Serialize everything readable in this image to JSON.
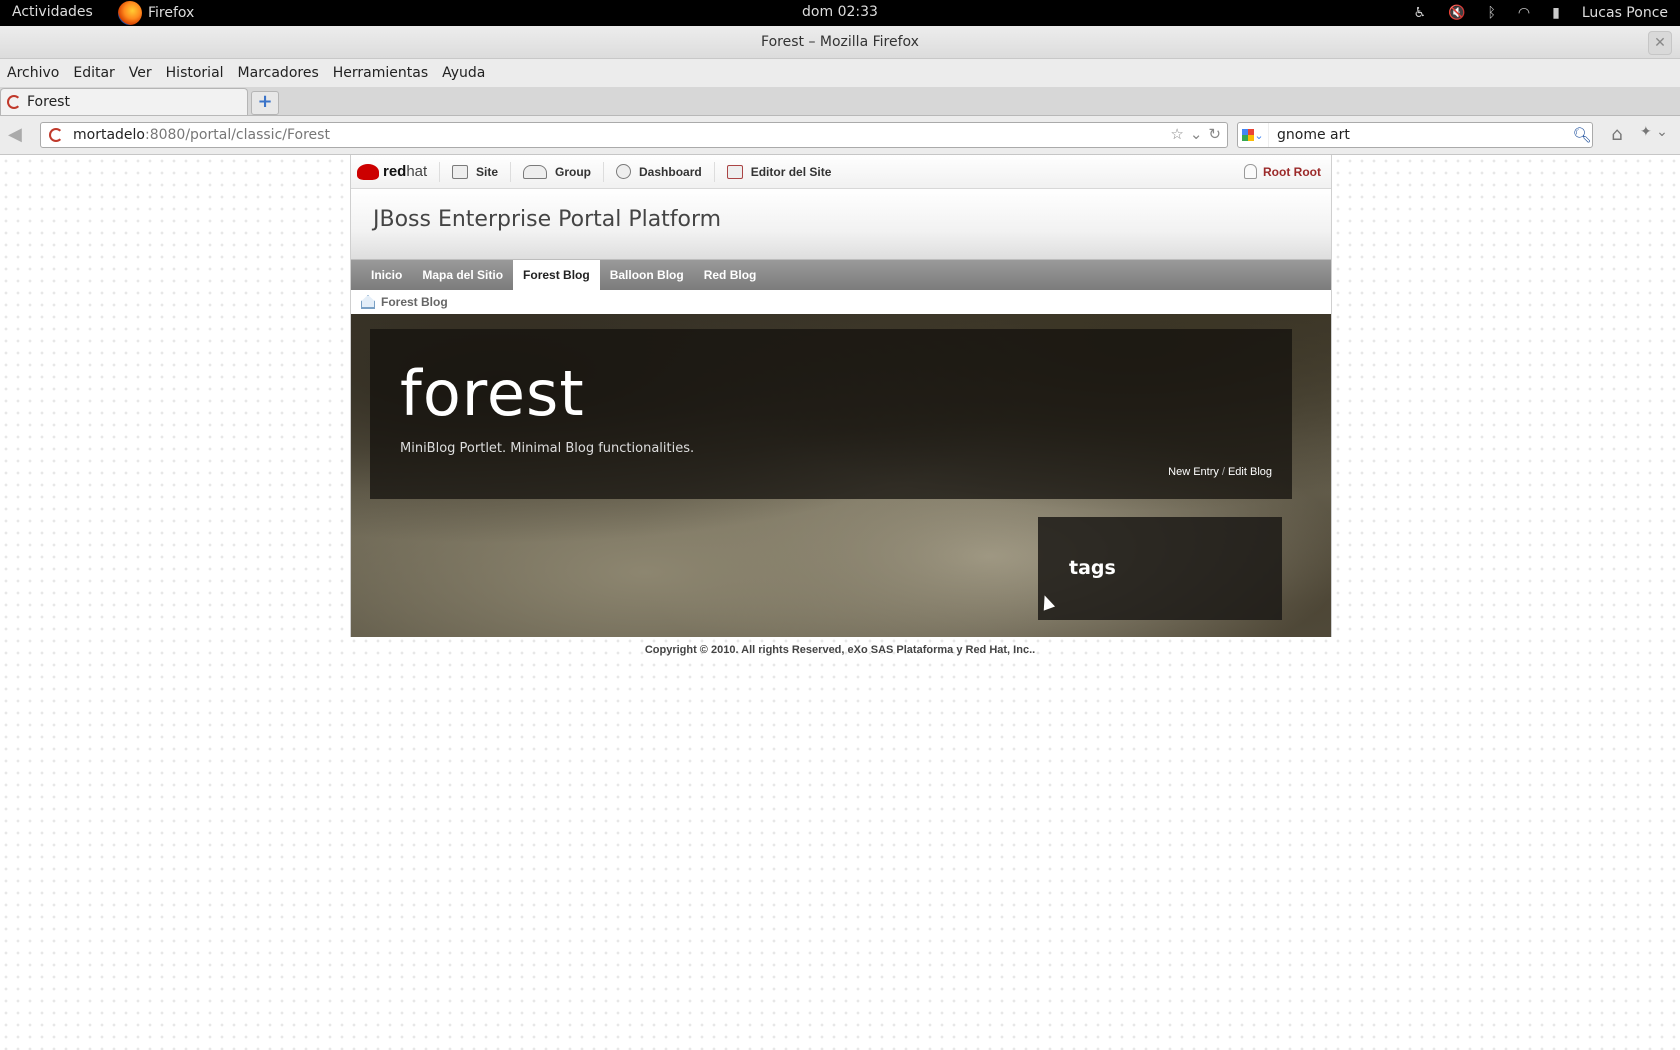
{
  "topbar": {
    "activities": "Actividades",
    "app": "Firefox",
    "clock": "dom 02:33",
    "user": "Lucas Ponce",
    "tray_icons": [
      "accessibility-icon",
      "volume-icon",
      "bluetooth-icon",
      "wifi-icon",
      "battery-icon"
    ]
  },
  "window": {
    "title": "Forest – Mozilla Firefox",
    "close": "✕"
  },
  "menubar": [
    "Archivo",
    "Editar",
    "Ver",
    "Historial",
    "Marcadores",
    "Herramientas",
    "Ayuda"
  ],
  "tab": {
    "label": "Forest",
    "new_tab": "+"
  },
  "navbar": {
    "url_host": "mortadelo",
    "url_rest": ":8080/portal/classic/Forest",
    "search_query": "gnome art"
  },
  "portal": {
    "logo": {
      "brand": "red",
      "brand2": "hat"
    },
    "toolbar": [
      {
        "label": "Site",
        "icon": "site-icon"
      },
      {
        "label": "Group",
        "icon": "group-icon"
      },
      {
        "label": "Dashboard",
        "icon": "dashboard-icon"
      },
      {
        "label": "Editor del Site",
        "icon": "editor-icon"
      }
    ],
    "user": "Root Root",
    "banner_title": "JBoss Enterprise Portal Platform",
    "nav": [
      "Inicio",
      "Mapa del Sitio",
      "Forest Blog",
      "Balloon Blog",
      "Red Blog"
    ],
    "nav_active": "Forest Blog",
    "breadcrumb": "Forest Blog",
    "blog": {
      "title": "forest",
      "description": "MiniBlog Portlet. Minimal Blog functionalities.",
      "new_entry": "New Entry",
      "separator": "/",
      "edit_blog": "Edit Blog",
      "tags_title": "tags"
    },
    "copyright": "Copyright © 2010. All rights Reserved, eXo SAS Plataforma y Red Hat, Inc.."
  },
  "colors": {
    "accent": "#cc0000",
    "user_link": "#9b2929",
    "nav_bg": "#8a8a8a"
  }
}
